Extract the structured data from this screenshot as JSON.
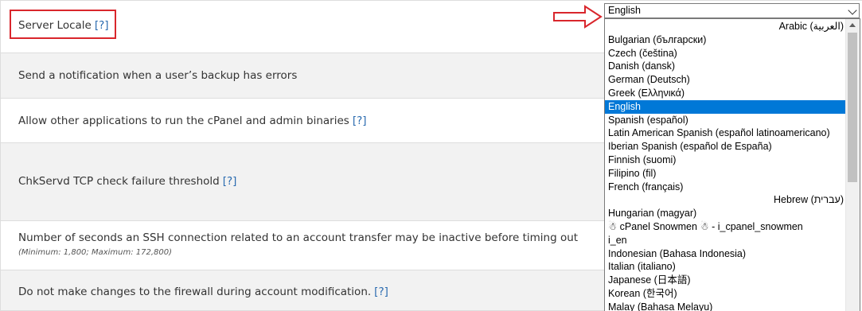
{
  "settings": [
    {
      "label": "Server Locale",
      "help": "[?]"
    },
    {
      "label": "Send a notification when a user’s backup has errors"
    },
    {
      "label": "Allow other applications to run the cPanel and admin binaries",
      "help": "[?]"
    },
    {
      "label": "ChkServd TCP check failure threshold",
      "help": "[?]"
    },
    {
      "label": "Number of seconds an SSH connection related to an account transfer may be inactive before timing out",
      "sub": "(Minimum: 1,800; Maximum: 172,800)"
    },
    {
      "label": "Do not make changes to the firewall during account modification.",
      "help": "[?]"
    }
  ],
  "locale_select": {
    "selected": "English",
    "options": [
      "Arabic (العربية)",
      "Bulgarian (български)",
      "Czech (čeština)",
      "Danish (dansk)",
      "German (Deutsch)",
      "Greek (Ελληνικά)",
      "English",
      "Spanish (español)",
      "Latin American Spanish (español latinoamericano)",
      "Iberian Spanish (español de España)",
      "Finnish (suomi)",
      "Filipino (fil)",
      "French (français)",
      "Hebrew (עברית)",
      "Hungarian (magyar)",
      "☃ cPanel Snowmen ☃ - i_cpanel_snowmen",
      "i_en",
      "Indonesian (Bahasa Indonesia)",
      "Italian (italiano)",
      "Japanese (日本語)",
      "Korean (한국어)",
      "Malay (Bahasa Melayu)"
    ],
    "rtl_options": [
      0,
      13
    ],
    "highlighted_index": 6
  },
  "colors": {
    "annotation": "#d9262c",
    "selection": "#0078d7",
    "help_link": "#2a6bb0"
  }
}
